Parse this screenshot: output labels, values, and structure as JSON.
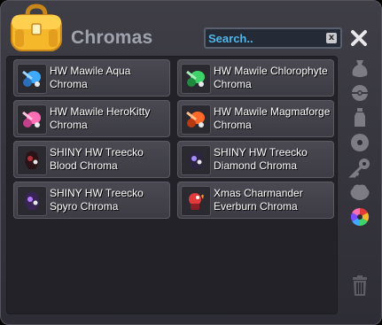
{
  "window": {
    "title": "Chromas"
  },
  "search": {
    "placeholder": "Search..",
    "value": "",
    "clear_label": "x"
  },
  "items": [
    {
      "label": "HW Mawile Aqua\nChroma",
      "color": "#3fa8ff",
      "icon": "mawile-aqua-icon"
    },
    {
      "label": "HW Mawile Chlorophyte\nChroma",
      "color": "#3fd46a",
      "icon": "mawile-chlorophyte-icon"
    },
    {
      "label": "HW Mawile HeroKitty\nChroma",
      "color": "#ff6fb5",
      "icon": "mawile-herokitty-icon"
    },
    {
      "label": "HW Mawile Magmaforge\nChroma",
      "color": "#ff6a2a",
      "icon": "mawile-magmaforge-icon"
    },
    {
      "label": "SHINY HW Treecko\nBlood Chroma",
      "color": "#b0303a",
      "icon": "treecko-blood-icon"
    },
    {
      "label": "SHINY HW Treecko\nDiamond Chroma",
      "color": "#a58cff",
      "icon": "treecko-diamond-icon"
    },
    {
      "label": "SHINY HW Treecko\nSpyro Chroma",
      "color": "#b57cff",
      "icon": "treecko-spyro-icon"
    },
    {
      "label": "Xmas Charmander\nEverburn Chroma",
      "color": "#e23a3a",
      "icon": "charmander-everburn-icon"
    }
  ],
  "sidebar": [
    {
      "name": "sack-tab-icon"
    },
    {
      "name": "pokeball-tab-icon"
    },
    {
      "name": "potion-tab-icon"
    },
    {
      "name": "disc-tab-icon"
    },
    {
      "name": "key-tab-icon"
    },
    {
      "name": "costume-tab-icon"
    },
    {
      "name": "chroma-wheel-tab-icon"
    },
    {
      "name": "trash-icon"
    }
  ],
  "colors": {
    "search_text": "#4fb7ea",
    "title_text": "#9fa3ad",
    "bag_yellow": "#f5b82a"
  }
}
